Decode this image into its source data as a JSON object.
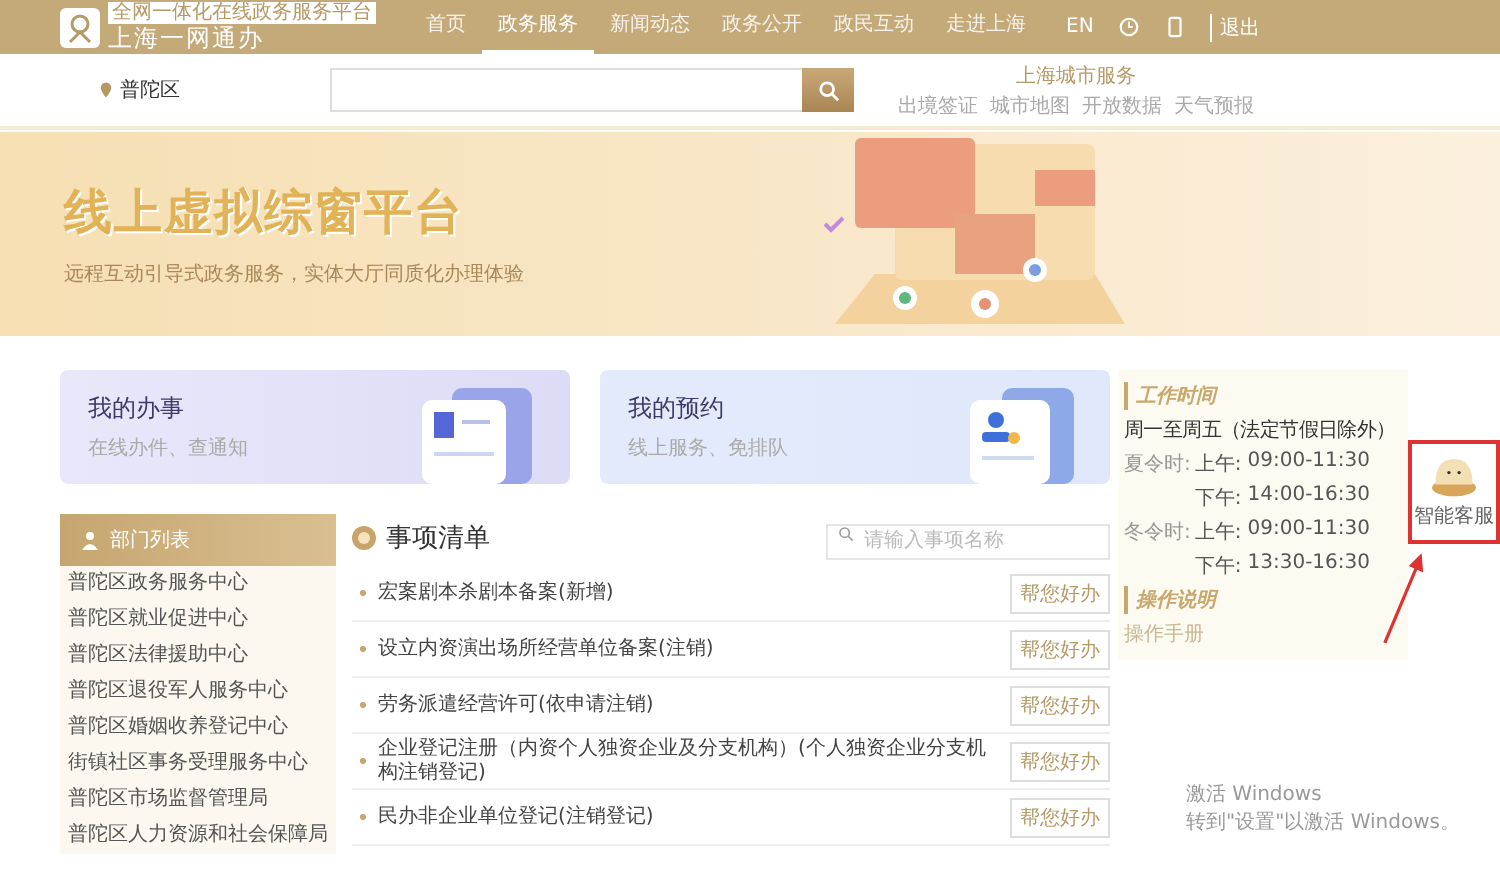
{
  "header": {
    "badge": "全网一体化在线政务服务平台",
    "logo_text": "上海一网通办",
    "nav": [
      {
        "label": "首页",
        "selected": false
      },
      {
        "label": "政务服务",
        "selected": true
      },
      {
        "label": "新闻动态",
        "selected": false
      },
      {
        "label": "政务公开",
        "selected": false
      },
      {
        "label": "政民互动",
        "selected": false
      },
      {
        "label": "走进上海",
        "selected": false
      }
    ],
    "lang": "EN",
    "logout": "退出"
  },
  "searchbar": {
    "location": "普陀区",
    "city_title": "上海城市服务",
    "city_links": [
      "出境签证",
      "城市地图",
      "开放数据",
      "天气预报"
    ]
  },
  "banner": {
    "title": "线上虚拟综窗平台",
    "subtitle": "远程互动引导式政务服务，实体大厅同质化办理体验"
  },
  "cards": [
    {
      "title": "我的办事",
      "subtitle": "在线办件、查通知",
      "kind": "doc"
    },
    {
      "title": "我的预约",
      "subtitle": "线上服务、免排队",
      "kind": "person"
    }
  ],
  "departments": {
    "title": "部门列表",
    "items": [
      "普陀区政务服务中心",
      "普陀区就业促进中心",
      "普陀区法律援助中心",
      "普陀区退役军人服务中心",
      "普陀区婚姻收养登记中心",
      "街镇社区事务受理服务中心",
      "普陀区市场监督管理局",
      "普陀区人力资源和社会保障局"
    ]
  },
  "matters": {
    "title": "事项清单",
    "search": {
      "placeholder": "请输入事项名称"
    },
    "rows": [
      {
        "name": "宏案剧本杀剧本备案(新增)",
        "action": "帮您好办"
      },
      {
        "name": "设立内资演出场所经营单位备案(注销)",
        "action": "帮您好办"
      },
      {
        "name": "劳务派遣经营许可(依申请注销)",
        "action": "帮您好办"
      },
      {
        "name": "企业登记注册（内资个人独资企业及分支机构）(个人独资企业分支机构注销登记)",
        "action": "帮您好办"
      },
      {
        "name": "民办非企业单位登记(注销登记)",
        "action": "帮您好办"
      }
    ]
  },
  "info": {
    "hours_title": "工作时间",
    "days": "周一至周五（法定节假日除外）",
    "seasons": [
      {
        "name": "夏令时:",
        "slots": [
          {
            "label": "上午:",
            "time": "09:00-11:30"
          },
          {
            "label": "下午:",
            "time": "14:00-16:30"
          }
        ]
      },
      {
        "name": "冬令时:",
        "slots": [
          {
            "label": "上午:",
            "time": "09:00-11:30"
          },
          {
            "label": "下午:",
            "time": "13:30-16:30"
          }
        ]
      }
    ],
    "guide_title": "操作说明",
    "guide_link": "操作手册"
  },
  "assistant": {
    "label": "智能客服"
  },
  "os_notice": {
    "title": "激活 Windows",
    "text": "转到\"设置\"以激活 Windows。"
  }
}
